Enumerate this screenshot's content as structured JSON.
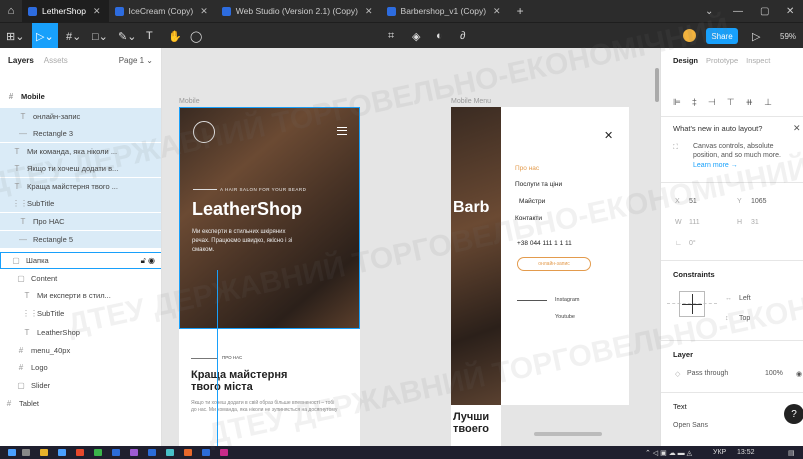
{
  "tabs": [
    {
      "label": "LetherShop",
      "active": true
    },
    {
      "label": "IceCream (Copy)",
      "active": false
    },
    {
      "label": "Web Studio (Version 2.1) (Copy)",
      "active": false
    },
    {
      "label": "Barbershop_v1 (Copy)",
      "active": false
    }
  ],
  "toolbar": {
    "share_label": "Share",
    "zoom": "59%"
  },
  "left_panel": {
    "tab_layers": "Layers",
    "tab_assets": "Assets",
    "page": "Page 1",
    "root": "Mobile",
    "layers": [
      {
        "icon": "T",
        "label": "онлайн-запис"
      },
      {
        "icon": "—",
        "label": "Rectangle 3"
      },
      {
        "icon": "T",
        "label": "Ми команда, яка ніколи ..."
      },
      {
        "icon": "T",
        "label": "Якщо ти хочеш додати в..."
      },
      {
        "icon": "T",
        "label": "Краща майстерня твого ..."
      },
      {
        "icon": "⋮⋮",
        "label": "SubTitle"
      },
      {
        "icon": "T",
        "label": "Про НАС"
      },
      {
        "icon": "—",
        "label": "Rectangle 5"
      },
      {
        "icon": "▢",
        "label": "Шапка"
      },
      {
        "icon": "▢",
        "label": "Content"
      },
      {
        "icon": "T",
        "label": "Ми експерти в стил..."
      },
      {
        "icon": "⋮⋮",
        "label": "SubTitle"
      },
      {
        "icon": "T",
        "label": "LeatherShop"
      },
      {
        "icon": "#",
        "label": "menu_40px"
      },
      {
        "icon": "#",
        "label": "Logo"
      },
      {
        "icon": "▢",
        "label": "Slider"
      },
      {
        "icon": "#",
        "label": "Tablet"
      }
    ]
  },
  "canvas": {
    "frame1_label": "Mobile",
    "frame2_label": "Mobile Menu",
    "hero_kicker": "A HAIR SALON FOR YOUR BEARD",
    "hero_title": "LeatherShop",
    "hero_text": "Ми експерти в стильних шкіряних речах. Працюємо швидко, якісно і зі смаком.",
    "section_tag": "ПРО НАС",
    "section_title": "Краща майстерня твого міста",
    "section_text": "Якщо ти хочеш додати в свій образ більше впевненості – тобі до нас. Ми команда, яка ніколи не зупиняється на досягнутому",
    "frame2_title": "Barb",
    "frame2_section_title": "Лучши твоего",
    "menu": [
      {
        "label": "Про нас",
        "active": true
      },
      {
        "label": "Послуги та ціни",
        "active": false
      },
      {
        "label": "Майстри",
        "active": false
      },
      {
        "label": "Контакти",
        "active": false
      }
    ],
    "phone": "+38 044 111 1 1 11",
    "booking_label": "онлайн-запис",
    "social": [
      "Instagram",
      "Youtube"
    ]
  },
  "right_panel": {
    "tab_design": "Design",
    "tab_prototype": "Prototype",
    "tab_inspect": "Inspect",
    "whats_new": "What's new in auto layout?",
    "whats_new_desc": "Canvas controls, absolute position, and so much more.",
    "learn_more": "Learn more →",
    "x_label": "X",
    "x_value": "51",
    "y_label": "Y",
    "y_value": "1065",
    "w_label": "W",
    "w_value": "111",
    "h_label": "H",
    "h_value": "31",
    "rotation": "0°",
    "constraints_title": "Constraints",
    "constraint_h": "Left",
    "constraint_v": "Top",
    "layer_title": "Layer",
    "blend_mode": "Pass through",
    "opacity": "100%",
    "text_title": "Text",
    "font": "Open Sans"
  },
  "taskbar": {
    "lang": "УКР",
    "time": "13:52"
  },
  "watermark": "ДТЕУ ДЕРЖАВНИЙ ТОРГОВЕЛЬНО-ЕКОНОМІЧНИЙ"
}
